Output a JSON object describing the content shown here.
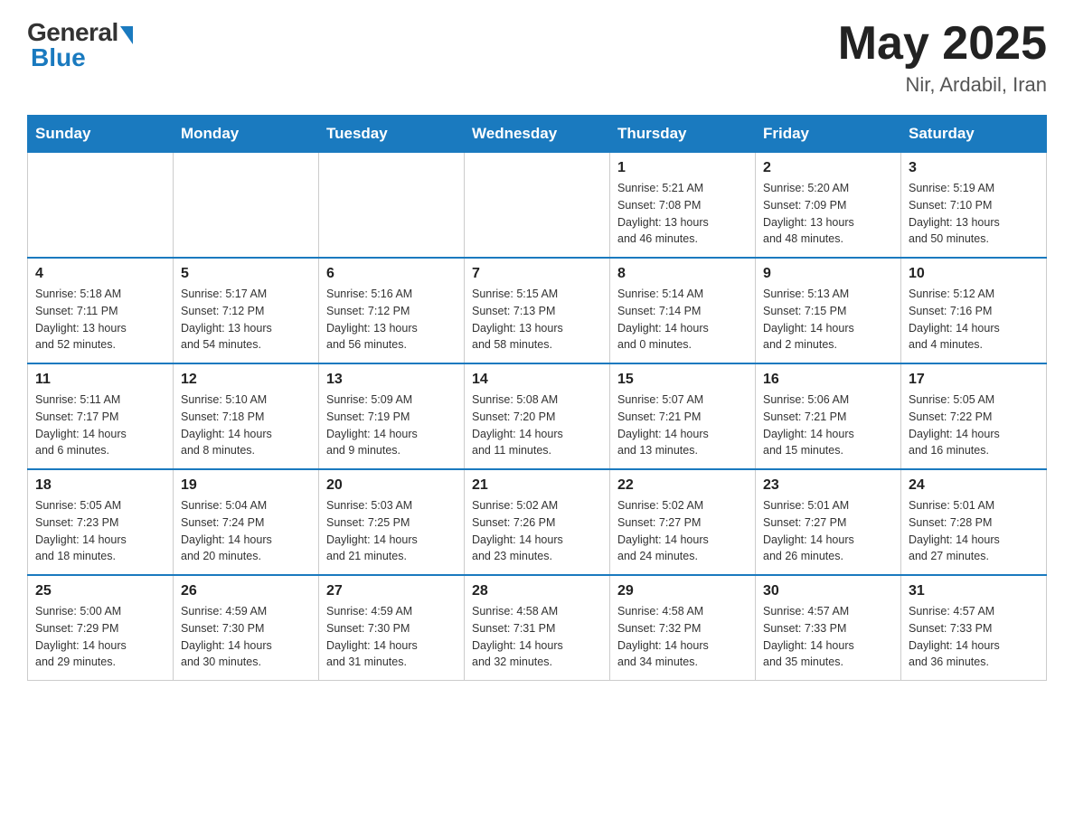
{
  "header": {
    "logo_general": "General",
    "logo_blue": "Blue",
    "month_title": "May 2025",
    "location": "Nir, Ardabil, Iran"
  },
  "days_of_week": [
    "Sunday",
    "Monday",
    "Tuesday",
    "Wednesday",
    "Thursday",
    "Friday",
    "Saturday"
  ],
  "weeks": [
    [
      {
        "day": "",
        "info": ""
      },
      {
        "day": "",
        "info": ""
      },
      {
        "day": "",
        "info": ""
      },
      {
        "day": "",
        "info": ""
      },
      {
        "day": "1",
        "info": "Sunrise: 5:21 AM\nSunset: 7:08 PM\nDaylight: 13 hours\nand 46 minutes."
      },
      {
        "day": "2",
        "info": "Sunrise: 5:20 AM\nSunset: 7:09 PM\nDaylight: 13 hours\nand 48 minutes."
      },
      {
        "day": "3",
        "info": "Sunrise: 5:19 AM\nSunset: 7:10 PM\nDaylight: 13 hours\nand 50 minutes."
      }
    ],
    [
      {
        "day": "4",
        "info": "Sunrise: 5:18 AM\nSunset: 7:11 PM\nDaylight: 13 hours\nand 52 minutes."
      },
      {
        "day": "5",
        "info": "Sunrise: 5:17 AM\nSunset: 7:12 PM\nDaylight: 13 hours\nand 54 minutes."
      },
      {
        "day": "6",
        "info": "Sunrise: 5:16 AM\nSunset: 7:12 PM\nDaylight: 13 hours\nand 56 minutes."
      },
      {
        "day": "7",
        "info": "Sunrise: 5:15 AM\nSunset: 7:13 PM\nDaylight: 13 hours\nand 58 minutes."
      },
      {
        "day": "8",
        "info": "Sunrise: 5:14 AM\nSunset: 7:14 PM\nDaylight: 14 hours\nand 0 minutes."
      },
      {
        "day": "9",
        "info": "Sunrise: 5:13 AM\nSunset: 7:15 PM\nDaylight: 14 hours\nand 2 minutes."
      },
      {
        "day": "10",
        "info": "Sunrise: 5:12 AM\nSunset: 7:16 PM\nDaylight: 14 hours\nand 4 minutes."
      }
    ],
    [
      {
        "day": "11",
        "info": "Sunrise: 5:11 AM\nSunset: 7:17 PM\nDaylight: 14 hours\nand 6 minutes."
      },
      {
        "day": "12",
        "info": "Sunrise: 5:10 AM\nSunset: 7:18 PM\nDaylight: 14 hours\nand 8 minutes."
      },
      {
        "day": "13",
        "info": "Sunrise: 5:09 AM\nSunset: 7:19 PM\nDaylight: 14 hours\nand 9 minutes."
      },
      {
        "day": "14",
        "info": "Sunrise: 5:08 AM\nSunset: 7:20 PM\nDaylight: 14 hours\nand 11 minutes."
      },
      {
        "day": "15",
        "info": "Sunrise: 5:07 AM\nSunset: 7:21 PM\nDaylight: 14 hours\nand 13 minutes."
      },
      {
        "day": "16",
        "info": "Sunrise: 5:06 AM\nSunset: 7:21 PM\nDaylight: 14 hours\nand 15 minutes."
      },
      {
        "day": "17",
        "info": "Sunrise: 5:05 AM\nSunset: 7:22 PM\nDaylight: 14 hours\nand 16 minutes."
      }
    ],
    [
      {
        "day": "18",
        "info": "Sunrise: 5:05 AM\nSunset: 7:23 PM\nDaylight: 14 hours\nand 18 minutes."
      },
      {
        "day": "19",
        "info": "Sunrise: 5:04 AM\nSunset: 7:24 PM\nDaylight: 14 hours\nand 20 minutes."
      },
      {
        "day": "20",
        "info": "Sunrise: 5:03 AM\nSunset: 7:25 PM\nDaylight: 14 hours\nand 21 minutes."
      },
      {
        "day": "21",
        "info": "Sunrise: 5:02 AM\nSunset: 7:26 PM\nDaylight: 14 hours\nand 23 minutes."
      },
      {
        "day": "22",
        "info": "Sunrise: 5:02 AM\nSunset: 7:27 PM\nDaylight: 14 hours\nand 24 minutes."
      },
      {
        "day": "23",
        "info": "Sunrise: 5:01 AM\nSunset: 7:27 PM\nDaylight: 14 hours\nand 26 minutes."
      },
      {
        "day": "24",
        "info": "Sunrise: 5:01 AM\nSunset: 7:28 PM\nDaylight: 14 hours\nand 27 minutes."
      }
    ],
    [
      {
        "day": "25",
        "info": "Sunrise: 5:00 AM\nSunset: 7:29 PM\nDaylight: 14 hours\nand 29 minutes."
      },
      {
        "day": "26",
        "info": "Sunrise: 4:59 AM\nSunset: 7:30 PM\nDaylight: 14 hours\nand 30 minutes."
      },
      {
        "day": "27",
        "info": "Sunrise: 4:59 AM\nSunset: 7:30 PM\nDaylight: 14 hours\nand 31 minutes."
      },
      {
        "day": "28",
        "info": "Sunrise: 4:58 AM\nSunset: 7:31 PM\nDaylight: 14 hours\nand 32 minutes."
      },
      {
        "day": "29",
        "info": "Sunrise: 4:58 AM\nSunset: 7:32 PM\nDaylight: 14 hours\nand 34 minutes."
      },
      {
        "day": "30",
        "info": "Sunrise: 4:57 AM\nSunset: 7:33 PM\nDaylight: 14 hours\nand 35 minutes."
      },
      {
        "day": "31",
        "info": "Sunrise: 4:57 AM\nSunset: 7:33 PM\nDaylight: 14 hours\nand 36 minutes."
      }
    ]
  ]
}
